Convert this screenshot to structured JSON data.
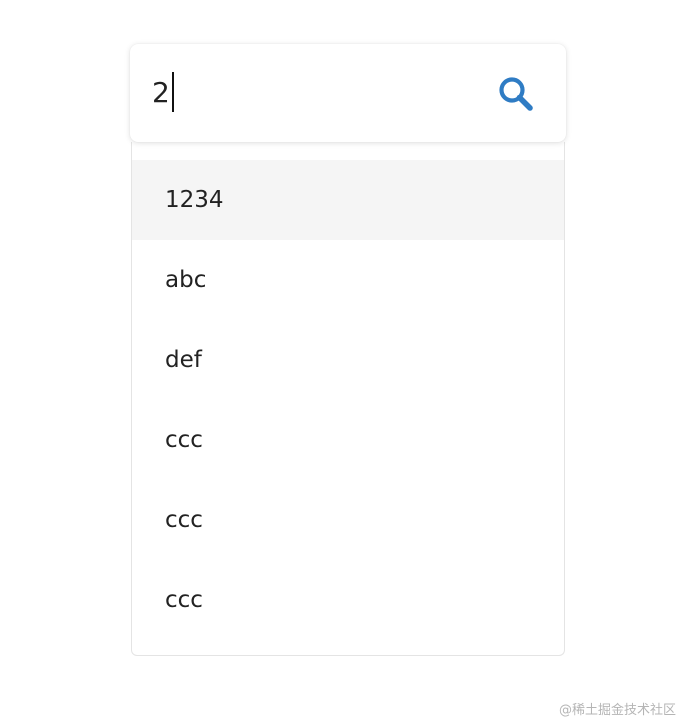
{
  "search": {
    "value": "2",
    "icon": "search-icon",
    "accent_color": "#2f7cc4"
  },
  "dropdown": {
    "highlighted_index": 0,
    "options": [
      {
        "label": "1234"
      },
      {
        "label": "abc"
      },
      {
        "label": "def"
      },
      {
        "label": "ccc"
      },
      {
        "label": "ccc"
      },
      {
        "label": "ccc"
      }
    ]
  },
  "watermark": {
    "text": "@稀土掘金技术社区"
  }
}
